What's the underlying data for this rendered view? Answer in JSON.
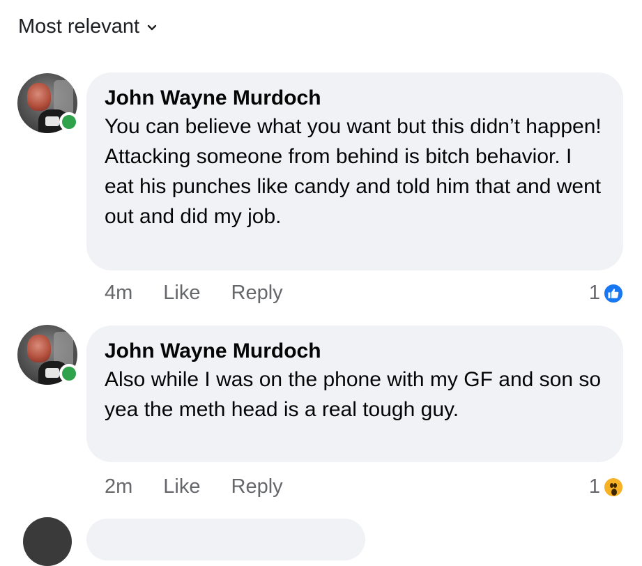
{
  "sort": {
    "label": "Most relevant"
  },
  "comments": [
    {
      "author": "John Wayne Murdoch",
      "text": "You can believe what you want but this didn’t happen! Attacking someone from behind is bitch behavior. I eat his punches like candy and told him that and went out and did my job.",
      "time": "4m",
      "like_label": "Like",
      "reply_label": "Reply",
      "reaction_count": "1",
      "reaction_icon": "like-icon",
      "online": true
    },
    {
      "author": "John Wayne Murdoch",
      "text": "Also while I was on the phone with my GF and son so yea the meth head is a real tough guy.",
      "time": "2m",
      "like_label": "Like",
      "reply_label": "Reply",
      "reaction_count": "1",
      "reaction_icon": "wow-icon",
      "online": true
    }
  ],
  "colors": {
    "bubble": "#f0f2f5",
    "online": "#31a24c",
    "like": "#1877f2",
    "wow": "#f7b125",
    "meta_text": "#65676b"
  }
}
